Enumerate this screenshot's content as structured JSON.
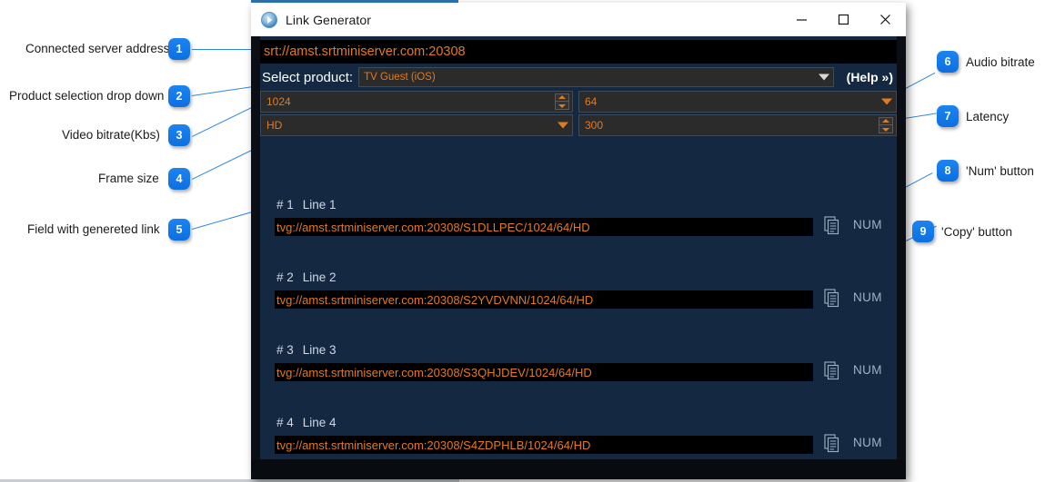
{
  "window": {
    "title": "Link Generator",
    "icon": "app-disc-icon",
    "controls": {
      "minimize": "minimize-icon",
      "maximize": "maximize-icon",
      "close": "close-icon"
    }
  },
  "form": {
    "server_address": "srt://amst.srtminiserver.com:20308",
    "product_label": "Select product:",
    "product_value": "TV Guest (iOS)",
    "help_label": "(Help »)",
    "video_bitrate": "1024",
    "audio_bitrate": "64",
    "frame_size": "HD",
    "latency": "300"
  },
  "links": [
    {
      "num": "# 1",
      "name": "Line 1",
      "url": "tvg://amst.srtminiserver.com:20308/S1DLLPEC/1024/64/HD",
      "copy": "copy-icon",
      "num_button": "NUM"
    },
    {
      "num": "# 2",
      "name": "Line 2",
      "url": "tvg://amst.srtminiserver.com:20308/S2YVDVNN/1024/64/HD",
      "copy": "copy-icon",
      "num_button": "NUM"
    },
    {
      "num": "# 3",
      "name": "Line 3",
      "url": "tvg://amst.srtminiserver.com:20308/S3QHJDEV/1024/64/HD",
      "copy": "copy-icon",
      "num_button": "NUM"
    },
    {
      "num": "# 4",
      "name": "Line 4",
      "url": "tvg://amst.srtminiserver.com:20308/S4ZDPHLB/1024/64/HD",
      "copy": "copy-icon",
      "num_button": "NUM"
    }
  ],
  "annotations": [
    {
      "id": "1",
      "label": "Connected server address"
    },
    {
      "id": "2",
      "label": "Product selection drop down"
    },
    {
      "id": "3",
      "label": "Video bitrate(Kbs)"
    },
    {
      "id": "4",
      "label": "Frame size"
    },
    {
      "id": "5",
      "label": "Field with genereted link"
    },
    {
      "id": "6",
      "label": "Audio bitrate"
    },
    {
      "id": "7",
      "label": "Latency"
    },
    {
      "id": "8",
      "label": "'Num' button"
    },
    {
      "id": "9",
      "label": "'Copy' button"
    }
  ],
  "colors": {
    "accent_orange": "#e07b1f",
    "panel_blue": "#142941",
    "badge_blue": "#0d6fe0",
    "leader_blue": "#2f86de"
  }
}
